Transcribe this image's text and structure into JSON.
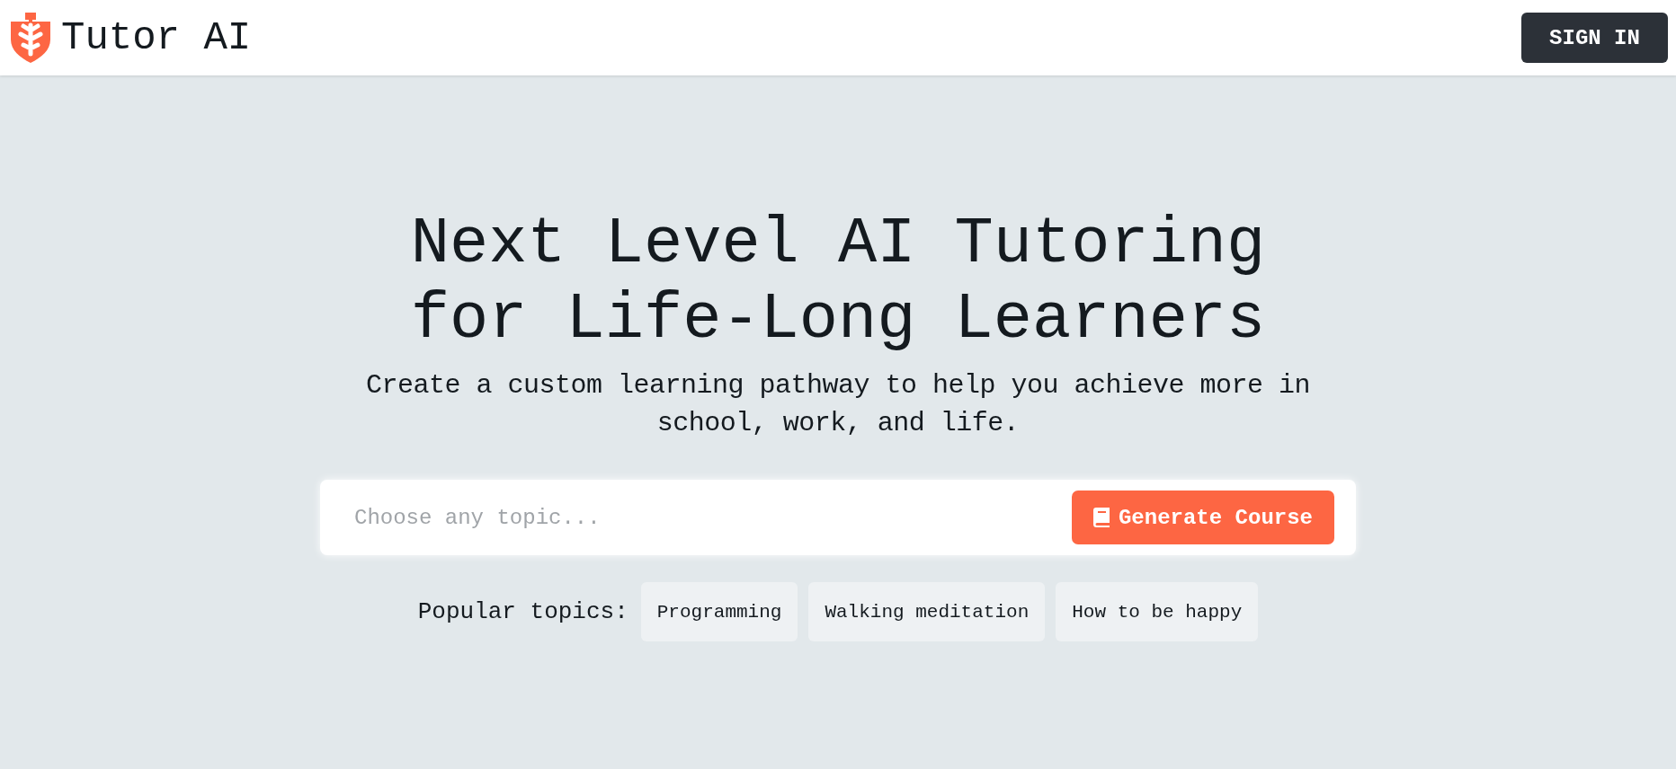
{
  "header": {
    "brand": "Tutor AI",
    "sign_in": "SIGN IN"
  },
  "hero": {
    "title_lines": [
      "Next Level AI Tutoring",
      "for Life-Long Learners"
    ],
    "subtitle": "Create a custom learning pathway to help you achieve more in school, work, and life."
  },
  "search": {
    "placeholder": "Choose any topic...",
    "button": "Generate Course"
  },
  "popular": {
    "label": "Popular topics:",
    "topics": [
      "Programming",
      "Walking meditation",
      "How to be happy"
    ]
  }
}
